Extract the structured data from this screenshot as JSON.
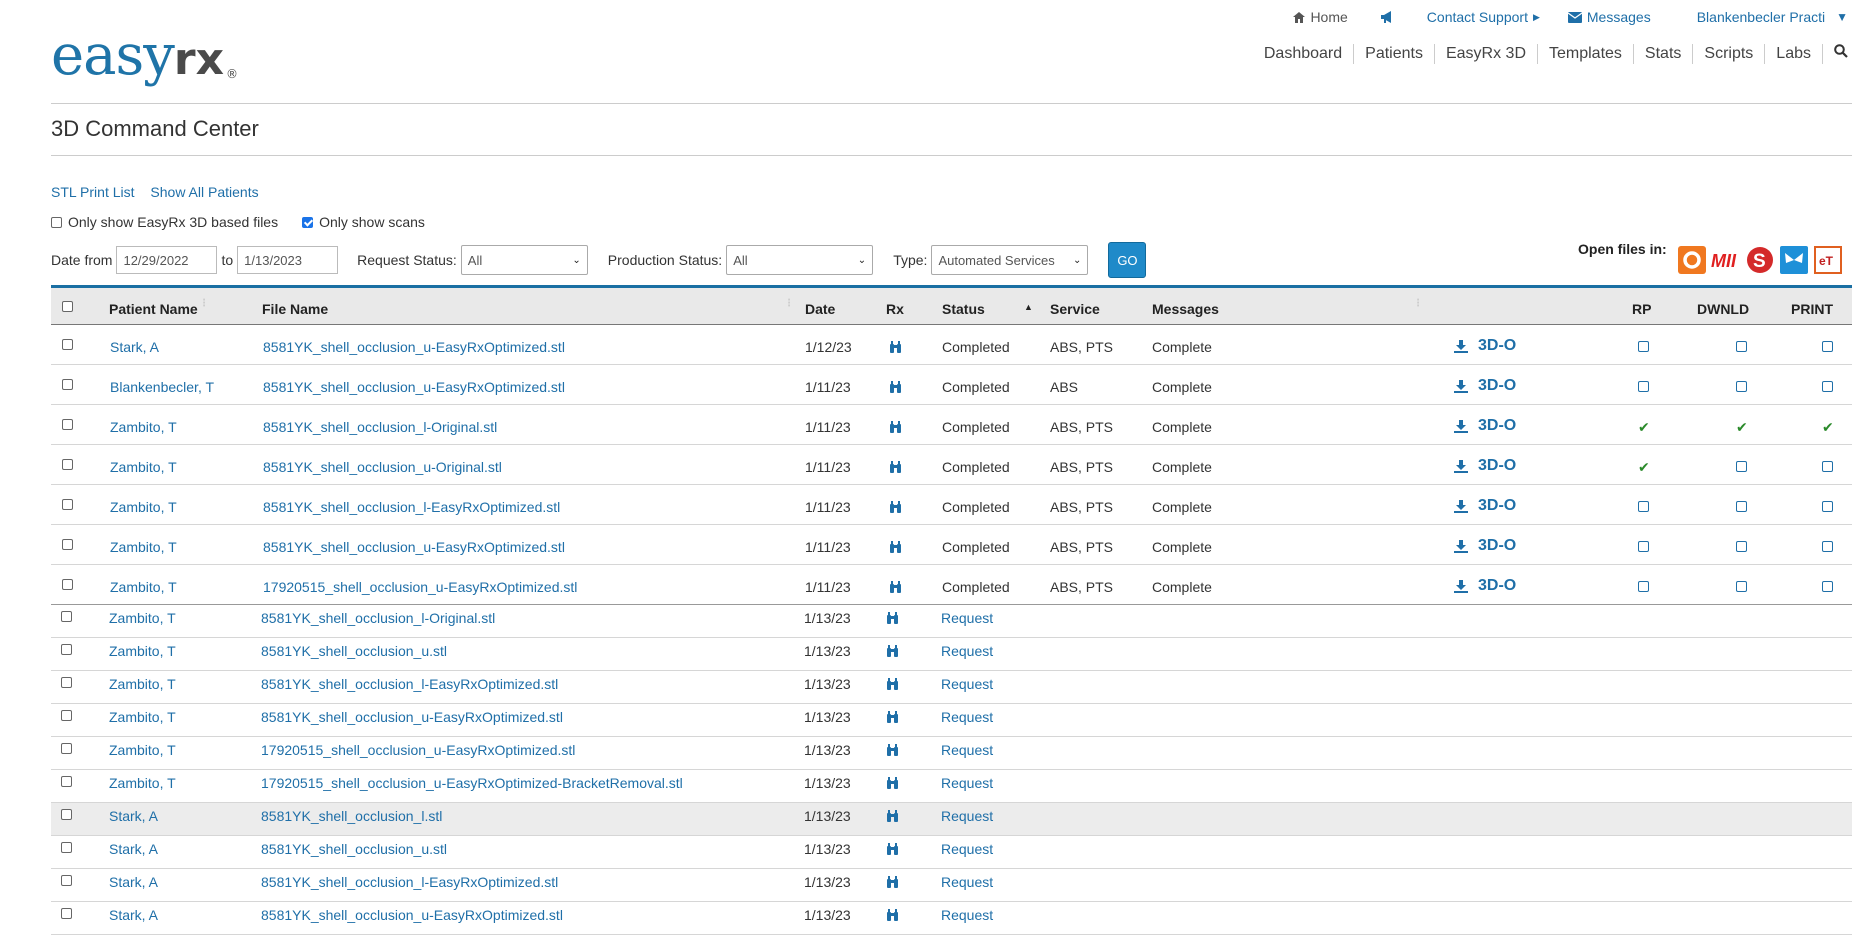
{
  "brand": {
    "name_light": "easy",
    "name_bold": "rx",
    "reg": "®"
  },
  "util_nav": {
    "home": "Home",
    "contact": "Contact Support",
    "messages": "Messages",
    "user": "Blankenbecler Practi"
  },
  "main_nav": [
    "Dashboard",
    "Patients",
    "EasyRx 3D",
    "Templates",
    "Stats",
    "Scripts",
    "Labs"
  ],
  "page_title": "3D Command Center",
  "links": {
    "stl_print_list": "STL Print List",
    "show_all_patients": "Show All Patients"
  },
  "checkboxes": {
    "only_easyrx_3d": {
      "label": "Only show EasyRx 3D based files",
      "checked": false
    },
    "only_scans": {
      "label": "Only show scans",
      "checked": true
    }
  },
  "filters": {
    "date_from_label": "Date from",
    "date_from": "12/29/2022",
    "to_label": "to",
    "date_to": "1/13/2023",
    "request_status_label": "Request Status:",
    "request_status": "All",
    "production_status_label": "Production Status:",
    "production_status": "All",
    "type_label": "Type:",
    "type": "Automated Services",
    "go": "GO"
  },
  "open_files_in": "Open files in:",
  "columns": {
    "patient": "Patient Name",
    "file": "File Name",
    "date": "Date",
    "rx": "Rx",
    "status": "Status",
    "service": "Service",
    "messages": "Messages",
    "rp": "RP",
    "dwnld": "DWNLD",
    "print": "PRINT"
  },
  "action_label": "3D-O",
  "completed_rows": [
    {
      "patient": "Stark, A",
      "file": "8581YK_shell_occlusion_u-EasyRxOptimized.stl",
      "date": "1/12/23",
      "status": "Completed",
      "service": "ABS, PTS",
      "message": "Complete",
      "rp": false,
      "dwnld": false,
      "print": false
    },
    {
      "patient": "Blankenbecler, T",
      "file": "8581YK_shell_occlusion_u-EasyRxOptimized.stl",
      "date": "1/11/23",
      "status": "Completed",
      "service": "ABS",
      "message": "Complete",
      "rp": false,
      "dwnld": false,
      "print": false
    },
    {
      "patient": "Zambito, T",
      "file": "8581YK_shell_occlusion_l-Original.stl",
      "date": "1/11/23",
      "status": "Completed",
      "service": "ABS, PTS",
      "message": "Complete",
      "rp": true,
      "dwnld": true,
      "print": true
    },
    {
      "patient": "Zambito, T",
      "file": "8581YK_shell_occlusion_u-Original.stl",
      "date": "1/11/23",
      "status": "Completed",
      "service": "ABS, PTS",
      "message": "Complete",
      "rp": true,
      "dwnld": false,
      "print": false
    },
    {
      "patient": "Zambito, T",
      "file": "8581YK_shell_occlusion_l-EasyRxOptimized.stl",
      "date": "1/11/23",
      "status": "Completed",
      "service": "ABS, PTS",
      "message": "Complete",
      "rp": false,
      "dwnld": false,
      "print": false
    },
    {
      "patient": "Zambito, T",
      "file": "8581YK_shell_occlusion_u-EasyRxOptimized.stl",
      "date": "1/11/23",
      "status": "Completed",
      "service": "ABS, PTS",
      "message": "Complete",
      "rp": false,
      "dwnld": false,
      "print": false
    },
    {
      "patient": "Zambito, T",
      "file": "17920515_shell_occlusion_u-EasyRxOptimized.stl",
      "date": "1/11/23",
      "status": "Completed",
      "service": "ABS, PTS",
      "message": "Complete",
      "rp": false,
      "dwnld": false,
      "print": false
    }
  ],
  "request_rows": [
    {
      "patient": "Zambito, T",
      "file": "8581YK_shell_occlusion_l-Original.stl",
      "date": "1/13/23",
      "status": "Request",
      "highlight": false
    },
    {
      "patient": "Zambito, T",
      "file": "8581YK_shell_occlusion_u.stl",
      "date": "1/13/23",
      "status": "Request",
      "highlight": false
    },
    {
      "patient": "Zambito, T",
      "file": "8581YK_shell_occlusion_l-EasyRxOptimized.stl",
      "date": "1/13/23",
      "status": "Request",
      "highlight": false
    },
    {
      "patient": "Zambito, T",
      "file": "8581YK_shell_occlusion_u-EasyRxOptimized.stl",
      "date": "1/13/23",
      "status": "Request",
      "highlight": false
    },
    {
      "patient": "Zambito, T",
      "file": "17920515_shell_occlusion_u-EasyRxOptimized.stl",
      "date": "1/13/23",
      "status": "Request",
      "highlight": false
    },
    {
      "patient": "Zambito, T",
      "file": "17920515_shell_occlusion_u-EasyRxOptimized-BracketRemoval.stl",
      "date": "1/13/23",
      "status": "Request",
      "highlight": false
    },
    {
      "patient": "Stark, A",
      "file": "8581YK_shell_occlusion_l.stl",
      "date": "1/13/23",
      "status": "Request",
      "highlight": true
    },
    {
      "patient": "Stark, A",
      "file": "8581YK_shell_occlusion_u.stl",
      "date": "1/13/23",
      "status": "Request",
      "highlight": false
    },
    {
      "patient": "Stark, A",
      "file": "8581YK_shell_occlusion_l-EasyRxOptimized.stl",
      "date": "1/13/23",
      "status": "Request",
      "highlight": false
    },
    {
      "patient": "Stark, A",
      "file": "8581YK_shell_occlusion_u-EasyRxOptimized.stl",
      "date": "1/13/23",
      "status": "Request",
      "highlight": false
    }
  ],
  "colors": {
    "link": "#1f6fa8",
    "accent": "#1a6fa3",
    "go": "#1f8ac9",
    "ok": "#2a8a2a"
  }
}
